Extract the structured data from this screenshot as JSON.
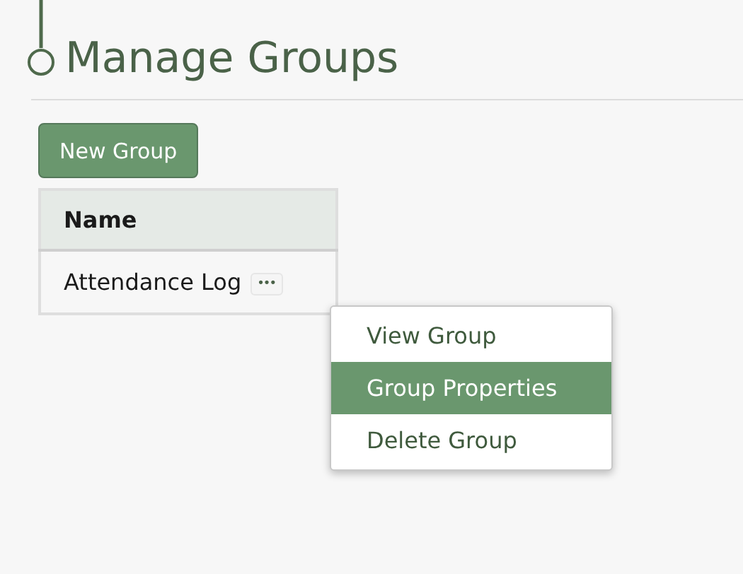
{
  "page": {
    "title": "Manage Groups"
  },
  "toolbar": {
    "new_button": "New Group"
  },
  "table": {
    "columns": [
      "Name"
    ],
    "rows": [
      {
        "name": "Attendance Log",
        "actions": "•••"
      }
    ]
  },
  "context_menu": {
    "items": [
      {
        "label": "View Group",
        "selected": false
      },
      {
        "label": "Group Properties",
        "selected": true
      },
      {
        "label": "Delete Group",
        "selected": false
      }
    ]
  }
}
